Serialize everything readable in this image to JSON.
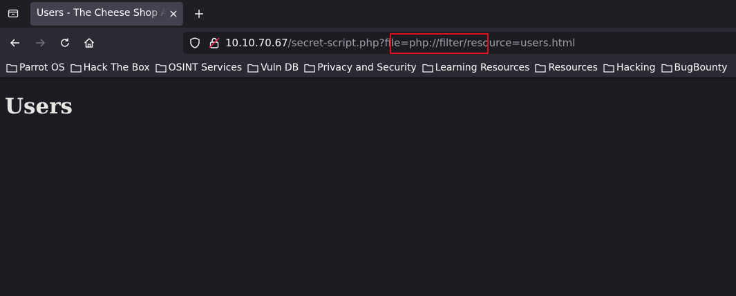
{
  "tab": {
    "title": "Users - The Cheese Shop Admin"
  },
  "address_bar": {
    "host": "10.10.70.67",
    "path_prefix": "/secret-script.php?file=",
    "highlighted": "php://filter/resource",
    "path_suffix": "=users.html"
  },
  "bookmarks": [
    {
      "label": "Parrot OS"
    },
    {
      "label": "Hack The Box"
    },
    {
      "label": "OSINT Services"
    },
    {
      "label": "Vuln DB"
    },
    {
      "label": "Privacy and Security"
    },
    {
      "label": "Learning Resources"
    },
    {
      "label": "Resources"
    },
    {
      "label": "Hacking"
    },
    {
      "label": "BugBounty"
    }
  ],
  "page": {
    "heading": "Users"
  },
  "colors": {
    "highlight_box": "#e0101b",
    "content_bg": "#1c1b22"
  }
}
